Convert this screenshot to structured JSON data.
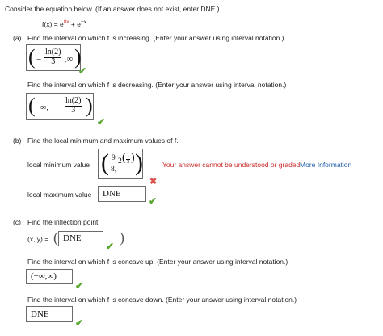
{
  "intro": "Consider the equation below. (If an answer does not exist, enter DNE.)",
  "equation": {
    "lhs": "f(x) = e",
    "exp1": "8x",
    "mid": " + e",
    "exp2": "−x"
  },
  "part_a": {
    "label": "(a)",
    "q1": "Find the interval on which f is increasing. (Enter your answer using interval notation.)",
    "a1": {
      "minus": "−",
      "num": "ln(2)",
      "den": "3",
      "rest": ",∞"
    },
    "q2": "Find the interval on which f is decreasing. (Enter your answer using interval notation.)",
    "a2": {
      "start": "−∞, −",
      "num": "ln(2)",
      "den": "3"
    }
  },
  "part_b": {
    "label": "(b)",
    "q": "Find the local minimum and maximum values of f.",
    "min_label": "local minimum value",
    "min_answer": {
      "top_num": "9",
      "base": "2",
      "exp_num": "1",
      "exp_den": "3",
      "bottom": "8,"
    },
    "error": "Your answer cannot be understood or graded.",
    "more_info": "More Information",
    "max_label": "local maximum value",
    "max_answer": "DNE"
  },
  "part_c": {
    "label": "(c)",
    "q1": "Find the inflection point.",
    "xy_label": "(x, y) =",
    "xy_open": "(",
    "xy_answer": "DNE",
    "xy_close": ")",
    "q2": "Find the interval on which f is concave up. (Enter your answer using interval notation.)",
    "a2": "(−∞,∞)",
    "q3": "Find the interval on which f is concave down. (Enter your answer using interval notation.)",
    "a3": "DNE"
  },
  "icons": {
    "correct": "✔",
    "incorrect": "✖"
  },
  "colors": {
    "correct": "#5aa832",
    "incorrect": "#d9534f",
    "error_text": "#cc2a2a",
    "link": "#1f5fa8"
  }
}
